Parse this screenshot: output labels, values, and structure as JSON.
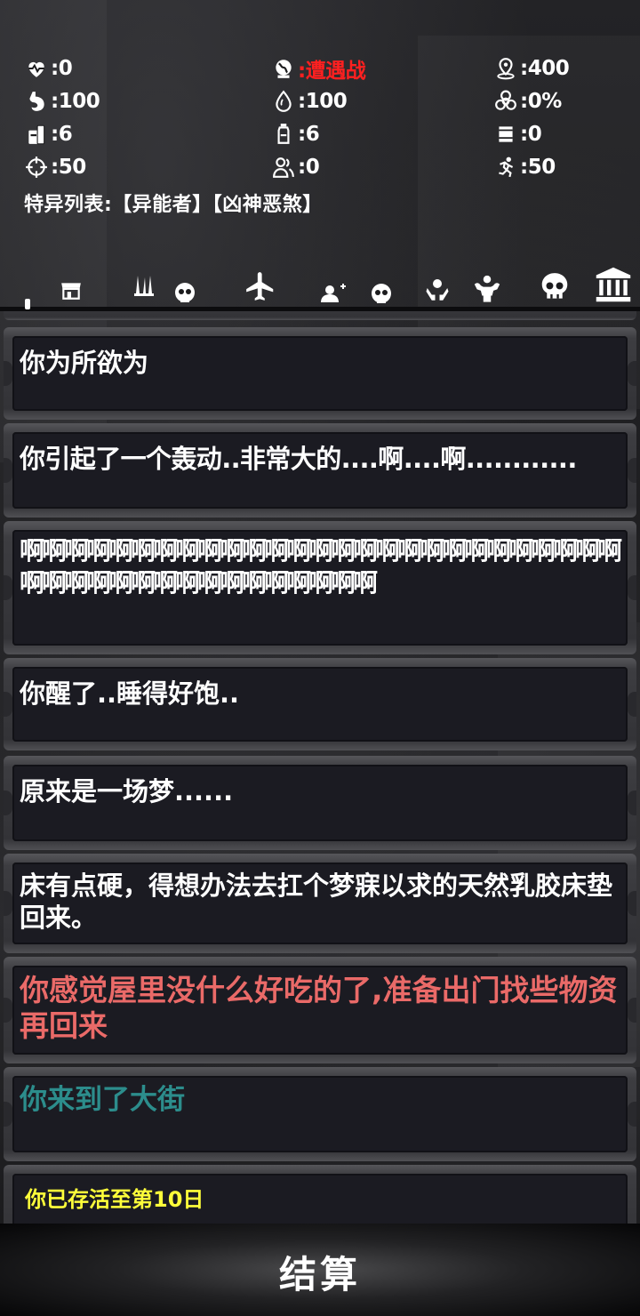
{
  "stats": [
    [
      {
        "icon": "heartbeat-icon",
        "value": ":0"
      },
      {
        "icon": "globe-encounter-icon",
        "value": ":遭遇战",
        "color": "#ff2020"
      },
      {
        "icon": "location-pin-icon",
        "value": ":400"
      }
    ],
    [
      {
        "icon": "stomach-icon",
        "value": ":100"
      },
      {
        "icon": "water-drop-icon",
        "value": ":100"
      },
      {
        "icon": "biohazard-icon",
        "value": ":0%"
      }
    ],
    [
      {
        "icon": "food-can-icon",
        "value": ":6"
      },
      {
        "icon": "water-bottle-icon",
        "value": ":6"
      },
      {
        "icon": "barrel-icon",
        "value": ":0"
      }
    ],
    [
      {
        "icon": "crosshair-icon",
        "value": ":50"
      },
      {
        "icon": "group-icon",
        "value": ":0"
      },
      {
        "icon": "running-person-icon",
        "value": ":50"
      }
    ]
  ],
  "special_traits": "特异列表:【异能者】【凶神恶煞】",
  "tabs": [
    {
      "icon": "shop-icon"
    },
    {
      "icon": "weapons-skull-icon"
    },
    {
      "icon": "airplane-icon"
    },
    {
      "icon": "add-user-skull-icon"
    },
    {
      "icon": "hands-skull-icon"
    },
    {
      "icon": "strongman-skull-icon"
    },
    {
      "icon": "bank-icon"
    }
  ],
  "messages": [
    {
      "text": "你为所欲为",
      "style": "normal"
    },
    {
      "text": "你引起了一个轰动..非常大的....啊....啊............",
      "style": "normal"
    },
    {
      "text": "啊啊啊啊啊啊啊啊啊啊啊啊啊啊啊啊啊啊啊啊啊啊啊啊啊啊啊啊啊啊啊啊啊啊啊啊啊啊啊啊啊啊啊",
      "style": "dense"
    },
    {
      "text": "你醒了..睡得好饱..",
      "style": "normal"
    },
    {
      "text": "原来是一场梦......",
      "style": "normal"
    },
    {
      "text": "床有点硬，得想办法去扛个梦寐以求的天然乳胶床垫回来。",
      "style": "normal"
    },
    {
      "text": "你感觉屋里没什么好吃的了,准备出门找些物资再回来",
      "style": "red"
    },
    {
      "text": "你来到了大街",
      "style": "teal"
    },
    {
      "text": "你已存活至第10日",
      "style": "yellow"
    }
  ],
  "settle_button": "结算",
  "colors": {
    "danger": "#ff2020",
    "red_text": "#ea6a68",
    "teal_text": "#2c8d8c",
    "yellow_text": "#ffff3a"
  }
}
